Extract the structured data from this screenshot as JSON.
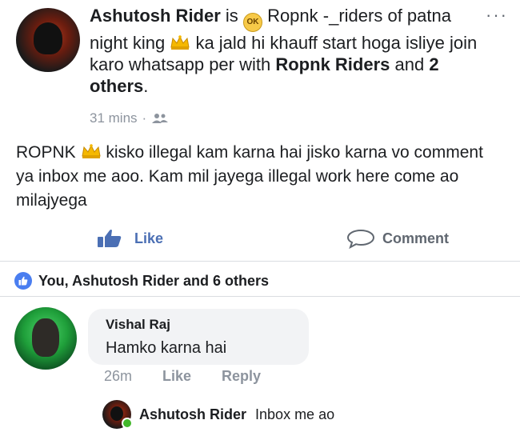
{
  "post": {
    "author": "Ashutosh Rider",
    "is_word": "is",
    "feeling_icon": "ok-emoji-icon",
    "header_part1": "Ropnk -_riders of patna night king",
    "header_part2": "ka jald hi khauff start hoga isliye join karo whatsapp per with",
    "with_name": "Ropnk Riders",
    "and_word": "and",
    "others": "2 others",
    "period": ".",
    "time": "31 mins",
    "dot": "·",
    "privacy_icon": "friends-icon",
    "more_icon": "more-options-icon",
    "body_part1": "ROPNK",
    "body_part2": "kisko illegal kam karna hai jisko karna vo comment ya inbox me aoo. Kam mil jayega illegal work here come ao  milajyega"
  },
  "actions": {
    "like_label": "Like",
    "comment_label": "Comment"
  },
  "reactions": {
    "summary": "You, Ashutosh Rider and 6 others"
  },
  "comment": {
    "name": "Vishal Raj",
    "text": "Hamko karna hai",
    "time": "26m",
    "like_label": "Like",
    "reply_label": "Reply"
  },
  "reply": {
    "name": "Ashutosh Rider",
    "text": "Inbox me ao"
  },
  "colors": {
    "link_blue": "#4b6fb4",
    "like_badge": "#4a7ef0",
    "meta_gray": "#8d949e",
    "online_green": "#42b72a"
  }
}
